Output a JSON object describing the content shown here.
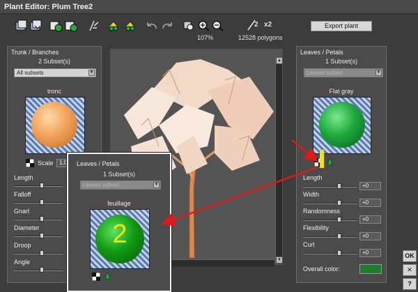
{
  "window": {
    "title": "Plant Editor:  Plum Tree2"
  },
  "toolbar": {
    "zoom": "107%",
    "polygons": "12528 polygons",
    "subdiv_a": "2",
    "subdiv_b": "x2",
    "export_label": "Export plant"
  },
  "trunk": {
    "title": "Trunk / Branches",
    "subsets_count": "2 Subset(s)",
    "subset_select": "All subsets",
    "material_name": "tronc",
    "scale_label": "Scale",
    "scale_value": "1.0",
    "sliders": [
      "Length",
      "Falloff",
      "Gnarl",
      "Diameter",
      "Droop",
      "Angle"
    ]
  },
  "leaves": {
    "title": "Leaves / Petals",
    "subsets_count": "1 Subset(s)",
    "subset_select": "Leaves subset",
    "material_name": "Flat gray",
    "sliders": [
      {
        "label": "Length",
        "value": "+0"
      },
      {
        "label": "Width",
        "value": "+0"
      },
      {
        "label": "Randomness",
        "value": "+0"
      },
      {
        "label": "Flexibility",
        "value": "+0"
      },
      {
        "label": "Curl",
        "value": "+0"
      }
    ],
    "overall_color_label": "Overall color:",
    "overall_color": "#1e7a2e"
  },
  "inset": {
    "title": "Leaves / Petals",
    "subsets_count": "1 Subset(s)",
    "subset_select": "Leaves subset",
    "material_name": "feuillage",
    "number": "2"
  },
  "annotation_number": "1",
  "side_buttons": {
    "ok": "OK",
    "close": "✕",
    "help": "?"
  },
  "colors": {
    "trunk_sphere": "#f2a25a",
    "leaf_sphere": "#1ea83c",
    "inset_sphere": "#129a12",
    "arrow": "#e01818",
    "marker": "#f2e600"
  }
}
